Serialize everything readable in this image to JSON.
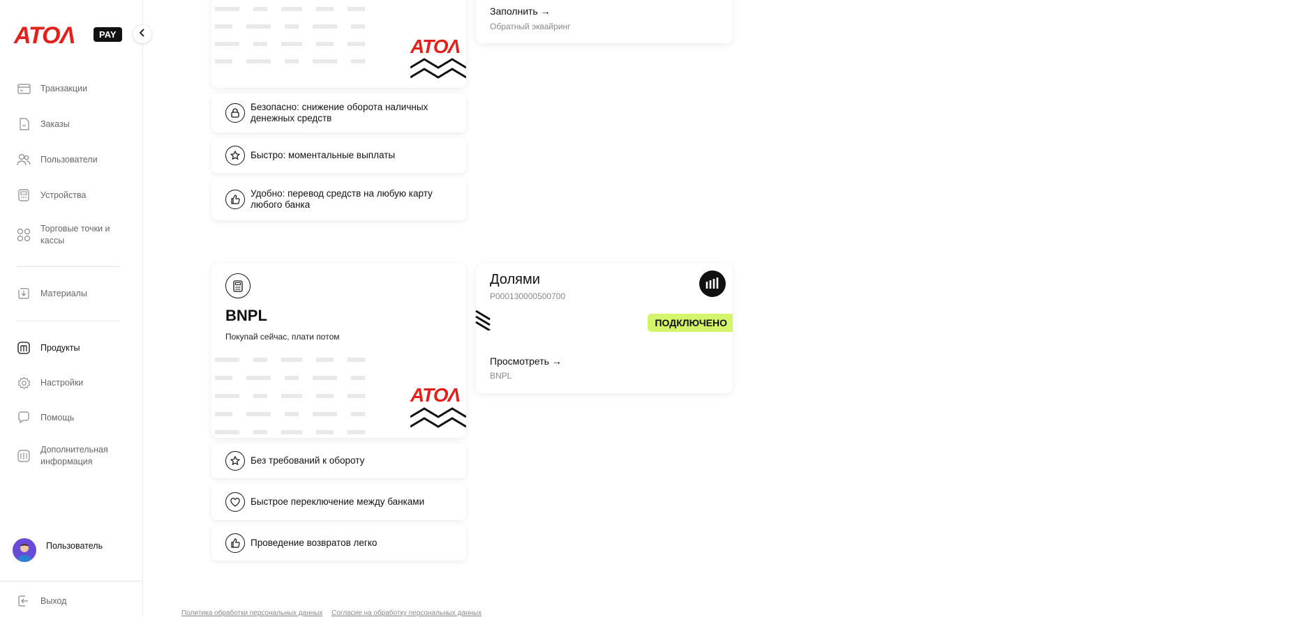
{
  "brand": {
    "logo_text": "ATOΛ",
    "badge": "PAY",
    "accent": "#e2211c"
  },
  "nav": {
    "items": [
      {
        "label": "Транзакции",
        "icon": "card-icon"
      },
      {
        "label": "Заказы",
        "icon": "document-icon"
      },
      {
        "label": "Пользователи",
        "icon": "users-icon"
      },
      {
        "label": "Устройства",
        "icon": "terminal-icon"
      },
      {
        "label": "Торговые точки и кассы",
        "icon": "stores-icon"
      },
      {
        "label": "Материалы",
        "icon": "download-icon"
      },
      {
        "label": "Продукты",
        "icon": "products-icon"
      },
      {
        "label": "Настройки",
        "icon": "gear-icon"
      },
      {
        "label": "Помощь",
        "icon": "chat-icon"
      },
      {
        "label": "Дополнительная информация",
        "icon": "book-icon"
      }
    ],
    "active": "Продукты",
    "user_name": "Пользователь",
    "logout": "Выход"
  },
  "top_section": {
    "features": [
      {
        "text": "Безопасно: снижение оборота наличных денежных средств",
        "icon": "lock-icon"
      },
      {
        "text": "Быстро: моментальные выплаты",
        "icon": "star-icon"
      },
      {
        "text": "Удобно: перевод средств на любую карту любого банка",
        "icon": "thumbs-up-icon"
      }
    ],
    "right_card": {
      "link": "Заполнить →",
      "subtitle": "Обратный эквайринг"
    }
  },
  "bnpl": {
    "title": "BNPL",
    "subtitle": "Покупай сейчас, плати потом",
    "features": [
      {
        "text": "Без требований к обороту",
        "icon": "star-icon"
      },
      {
        "text": "Быстрое переключение между банками",
        "icon": "heart-icon"
      },
      {
        "text": "Проведение возвратов легко",
        "icon": "thumbs-up-icon"
      }
    ],
    "partner": {
      "name": "Долями",
      "id": "P000130000500700",
      "status": "ПОДКЛЮЧЕНО",
      "status_color": "#d4f56b",
      "link": "Просмотреть →",
      "link_sub": "BNPL"
    }
  },
  "footer": {
    "privacy": "Политика обработки персональных данных",
    "consent": "Согласие на обработку персональных данных"
  }
}
